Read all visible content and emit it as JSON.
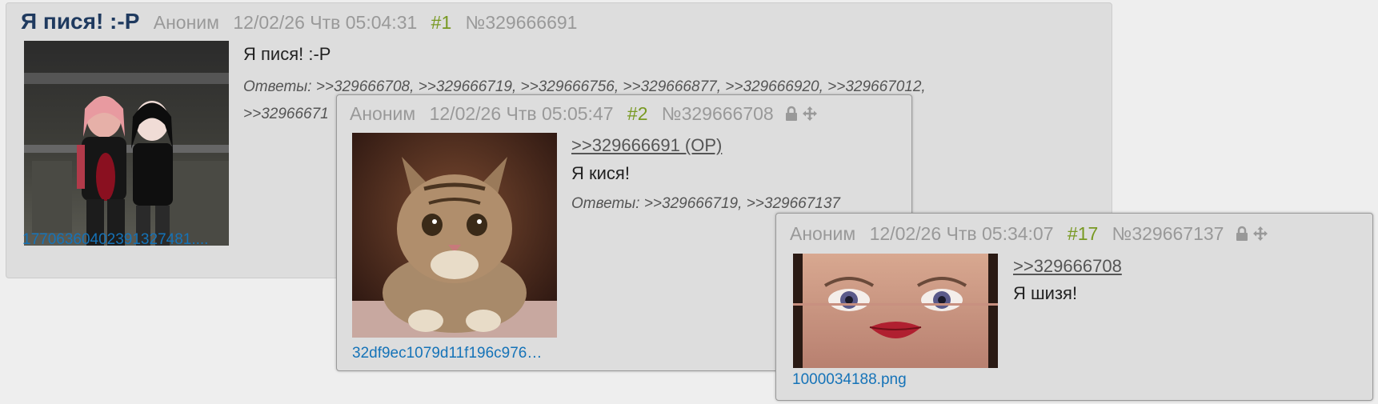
{
  "op": {
    "title": "Я пися! :-P",
    "author": "Аноним",
    "date": "12/02/26 Чтв 05:04:31",
    "order": "#1",
    "number": "№329666691",
    "message": "Я пися! :-P",
    "answers_label": "Ответы:",
    "answers": [
      ">>329666708",
      ">>329666719",
      ">>329666756",
      ">>329666877",
      ">>329666920",
      ">>329667012"
    ],
    "answers_line2_visible": ">>32966671",
    "file_name": "17706360402391327481...."
  },
  "popup1": {
    "author": "Аноним",
    "date": "12/02/26 Чтв 05:05:47",
    "order": "#2",
    "number": "№329666708",
    "reply_to": ">>329666691 (OP)",
    "message": "Я кися!",
    "answers_label": "Ответы:",
    "answers": [
      ">>329666719",
      ">>329667137"
    ],
    "file_name": "32df9ec1079d11f196c976…",
    "icons": [
      "lock-icon",
      "move-icon"
    ]
  },
  "popup2": {
    "author": "Аноним",
    "date": "12/02/26 Чтв 05:34:07",
    "order": "#17",
    "number": "№329667137",
    "reply_to": ">>329666708",
    "message": "Я шизя!",
    "file_name": "1000034188.png",
    "icons": [
      "lock-icon",
      "move-icon"
    ]
  },
  "colors": {
    "background": "#eeeeee",
    "post_bg": "#dddddd",
    "title": "#1f3a5f",
    "order": "#789922",
    "meta": "#999999",
    "file_link": "#1573b8"
  }
}
